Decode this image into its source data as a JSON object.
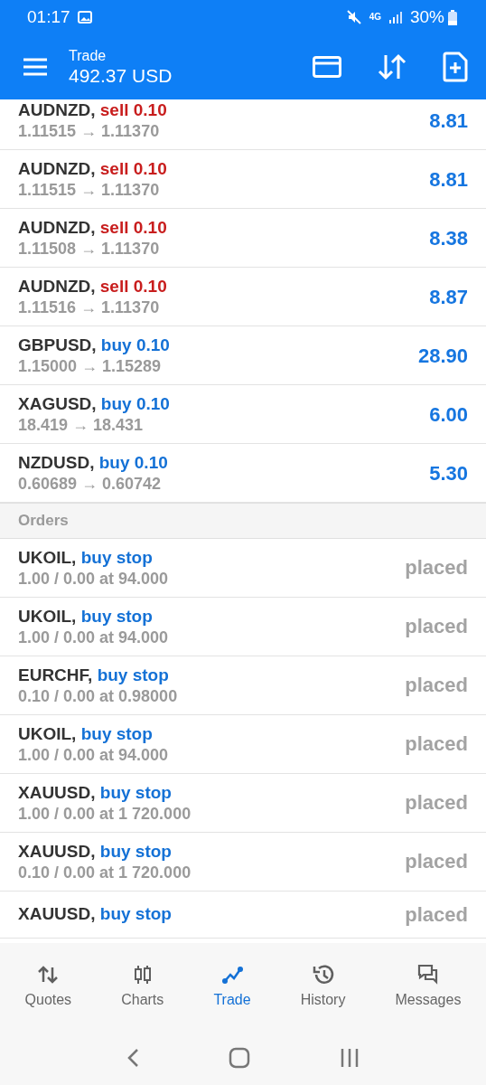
{
  "status_bar": {
    "time": "01:17",
    "network": "4G",
    "battery": "30%"
  },
  "header": {
    "title": "Trade",
    "balance": "492.37 USD"
  },
  "positions": [
    {
      "symbol": "AUDNZD,",
      "side": "sell",
      "volume": "0.10",
      "prices": "1.11515 → 1.11370",
      "profit": "8.81"
    },
    {
      "symbol": "AUDNZD,",
      "side": "sell",
      "volume": "0.10",
      "prices": "1.11515 → 1.11370",
      "profit": "8.81"
    },
    {
      "symbol": "AUDNZD,",
      "side": "sell",
      "volume": "0.10",
      "prices": "1.11508 → 1.11370",
      "profit": "8.38"
    },
    {
      "symbol": "AUDNZD,",
      "side": "sell",
      "volume": "0.10",
      "prices": "1.11516 → 1.11370",
      "profit": "8.87"
    },
    {
      "symbol": "GBPUSD,",
      "side": "buy",
      "volume": "0.10",
      "prices": "1.15000 → 1.15289",
      "profit": "28.90"
    },
    {
      "symbol": "XAGUSD,",
      "side": "buy",
      "volume": "0.10",
      "prices": "18.419 → 18.431",
      "profit": "6.00"
    },
    {
      "symbol": "NZDUSD,",
      "side": "buy",
      "volume": "0.10",
      "prices": "0.60689 → 0.60742",
      "profit": "5.30"
    }
  ],
  "orders_header": "Orders",
  "orders": [
    {
      "symbol": "UKOIL,",
      "type": "buy stop",
      "detail": "1.00 / 0.00 at 94.000",
      "state": "placed"
    },
    {
      "symbol": "UKOIL,",
      "type": "buy stop",
      "detail": "1.00 / 0.00 at 94.000",
      "state": "placed"
    },
    {
      "symbol": "EURCHF,",
      "type": "buy stop",
      "detail": "0.10 / 0.00 at 0.98000",
      "state": "placed"
    },
    {
      "symbol": "UKOIL,",
      "type": "buy stop",
      "detail": "1.00 / 0.00 at 94.000",
      "state": "placed"
    },
    {
      "symbol": "XAUUSD,",
      "type": "buy stop",
      "detail": "1.00 / 0.00 at 1 720.000",
      "state": "placed"
    },
    {
      "symbol": "XAUUSD,",
      "type": "buy stop",
      "detail": "0.10 / 0.00 at 1 720.000",
      "state": "placed"
    },
    {
      "symbol": "XAUUSD,",
      "type": "buy stop",
      "state": "placed"
    }
  ],
  "tabs": [
    {
      "kind": "quotes",
      "label": "Quotes",
      "selected": false
    },
    {
      "kind": "charts",
      "label": "Charts",
      "selected": false
    },
    {
      "kind": "trade",
      "label": "Trade",
      "selected": true
    },
    {
      "kind": "history",
      "label": "History",
      "selected": false
    },
    {
      "kind": "messages",
      "label": "Messages",
      "selected": false
    }
  ]
}
